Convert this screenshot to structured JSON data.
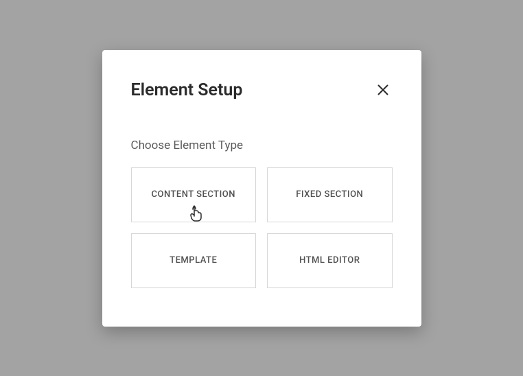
{
  "modal": {
    "title": "Element Setup",
    "section_label": "Choose Element Type",
    "options": [
      {
        "label": "CONTENT SECTION"
      },
      {
        "label": "FIXED SECTION"
      },
      {
        "label": "TEMPLATE"
      },
      {
        "label": "HTML EDITOR"
      }
    ]
  }
}
